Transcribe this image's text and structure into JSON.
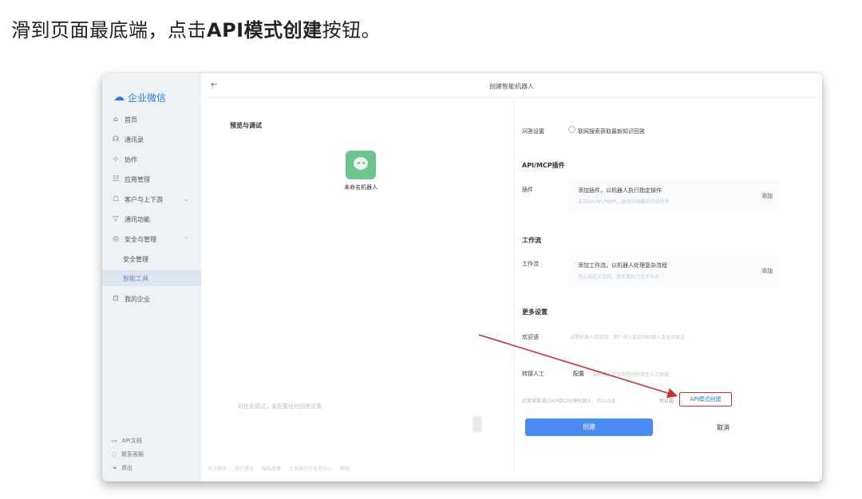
{
  "instruction": {
    "part1": "滑到页面最底端，点击",
    "bold": "API模式创建",
    "part2": "按钮。"
  },
  "sidebar": {
    "brand": "企业微信",
    "items": [
      {
        "icon": "⌂",
        "label": "首页"
      },
      {
        "icon": "☊",
        "label": "通讯录"
      },
      {
        "icon": "⊹",
        "label": "协作"
      },
      {
        "icon": "☷",
        "label": "应用管理"
      },
      {
        "icon": "☖",
        "label": "客户与上下游"
      },
      {
        "icon": "▽",
        "label": "通讯功能"
      },
      {
        "icon": "◎",
        "label": "安全与管理"
      }
    ],
    "sub_items": [
      "安全管理",
      "智能工具"
    ],
    "extra_item": {
      "icon": "⊡",
      "label": "我的企业"
    },
    "footer": [
      "API文档",
      "联系客服",
      "退出"
    ]
  },
  "main": {
    "back_icon": "←",
    "title": "创建智能机器人",
    "preview_title": "预览与调试",
    "bot_name": "未命名机器人",
    "preview_hint": "可在此调试，未配置任何回答设置",
    "knowledge": {
      "label": "问答设置",
      "option": "联网搜索获取最新知识回答"
    },
    "api_section": "API/MCP插件",
    "plugin_card": {
      "label": "插件",
      "title": "添加插件，以机器人执行指定操作",
      "desc": "支持API/MCP插件，调用外部服务完成任务",
      "button": "添加"
    },
    "workflow_section": "工作流",
    "workflow_card": {
      "label": "工作流",
      "title": "添加工作流，以机器人处理复杂流程",
      "desc": "可以自定义流程，按步骤执行任务节点",
      "button": "添加"
    },
    "more_section": "更多设置",
    "welcome": {
      "label": "欢迎语",
      "desc": "设置机器人欢迎语，用户进入会话时机器人会主动发送"
    },
    "handoff": {
      "label": "转接人工",
      "link": "配置",
      "desc": "当机器人无法回答时转接至人工客服"
    },
    "api_mode_text": "如果需要通过API接口创建机器人，可以点击",
    "api_mode_prefix": "可以选",
    "api_mode_button": "API模式创建",
    "create_button": "创建",
    "cancel_button": "取消"
  },
  "statusbar": [
    "关于腾讯",
    "用户协议",
    "隐私政策",
    "企业微信开发者中心",
    "帮助"
  ],
  "colors": {
    "accent": "#2d7be8",
    "button_blue": "#4a8cf3",
    "highlight_red": "#d9312f",
    "arrow_red": "#c8322e"
  }
}
